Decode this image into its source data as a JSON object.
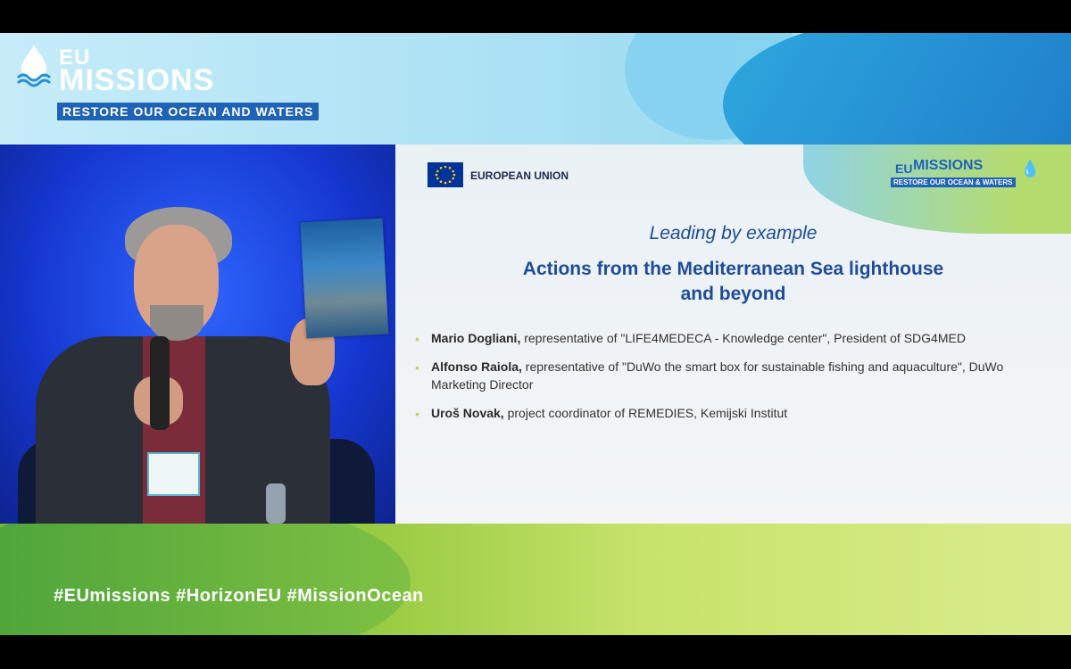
{
  "branding": {
    "eu": "EU",
    "missions": "MISSIONS",
    "tagline": "RESTORE OUR OCEAN AND WATERS",
    "hashtags": "#EUmissions  #HorizonEU  #MissionOcean"
  },
  "slide": {
    "eu_label": "EUROPEAN UNION",
    "mini_logo": {
      "eu": "EU",
      "missions": "MISSIONS",
      "tagline": "RESTORE OUR OCEAN & WATERS"
    },
    "subtitle": "Leading by example",
    "title_line1": "Actions from the Mediterranean Sea lighthouse",
    "title_line2": "and beyond",
    "speakers": [
      {
        "name": "Mario Dogliani,",
        "desc": " representative of \"LIFE4MEDECA - Knowledge center\", President of SDG4MED"
      },
      {
        "name": "Alfonso Raiola,",
        "desc": " representative of \"DuWo the smart box for sustainable fishing and aquaculture\", DuWo Marketing Director"
      },
      {
        "name": "Uroš Novak,",
        "desc": " project coordinator of REMEDIES, Kemijski Institut"
      }
    ]
  },
  "colors": {
    "brand_blue": "#1e63b6",
    "title_blue": "#1e4c9a",
    "bullet_green": "#b6d35f"
  }
}
